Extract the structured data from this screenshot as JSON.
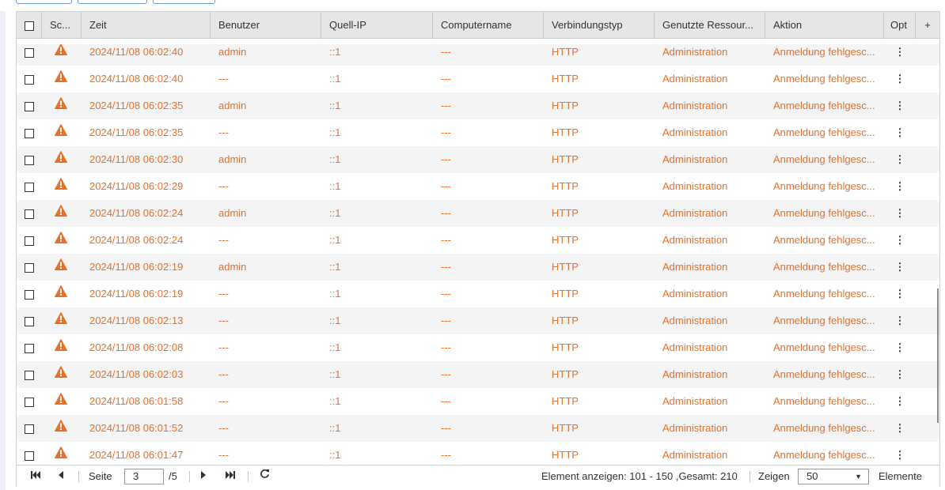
{
  "columns": {
    "select_all": "",
    "severity": "Sc...",
    "time": "Zeit",
    "user": "Benutzer",
    "source_ip": "Quell-IP",
    "computer_name": "Computername",
    "connection_type": "Verbindungstyp",
    "resource": "Genutzte Ressour...",
    "action": "Aktion",
    "options": "Opt",
    "add": "+"
  },
  "rows": [
    {
      "time": "2024/11/08 06:02:40",
      "user": "admin",
      "ip": "::1",
      "computer": "---",
      "conn": "HTTP",
      "resource": "Administration",
      "action": "Anmeldung fehlgesc...",
      "severity_icon": "warning-icon"
    },
    {
      "time": "2024/11/08 06:02:40",
      "user": "---",
      "ip": "::1",
      "computer": "---",
      "conn": "HTTP",
      "resource": "Administration",
      "action": "Anmeldung fehlgesc...",
      "severity_icon": "warning-icon"
    },
    {
      "time": "2024/11/08 06:02:35",
      "user": "admin",
      "ip": "::1",
      "computer": "---",
      "conn": "HTTP",
      "resource": "Administration",
      "action": "Anmeldung fehlgesc...",
      "severity_icon": "warning-icon"
    },
    {
      "time": "2024/11/08 06:02:35",
      "user": "---",
      "ip": "::1",
      "computer": "---",
      "conn": "HTTP",
      "resource": "Administration",
      "action": "Anmeldung fehlgesc...",
      "severity_icon": "warning-icon"
    },
    {
      "time": "2024/11/08 06:02:30",
      "user": "admin",
      "ip": "::1",
      "computer": "---",
      "conn": "HTTP",
      "resource": "Administration",
      "action": "Anmeldung fehlgesc...",
      "severity_icon": "warning-icon"
    },
    {
      "time": "2024/11/08 06:02:29",
      "user": "---",
      "ip": "::1",
      "computer": "---",
      "conn": "HTTP",
      "resource": "Administration",
      "action": "Anmeldung fehlgesc...",
      "severity_icon": "warning-icon"
    },
    {
      "time": "2024/11/08 06:02:24",
      "user": "admin",
      "ip": "::1",
      "computer": "---",
      "conn": "HTTP",
      "resource": "Administration",
      "action": "Anmeldung fehlgesc...",
      "severity_icon": "warning-icon"
    },
    {
      "time": "2024/11/08 06:02:24",
      "user": "---",
      "ip": "::1",
      "computer": "---",
      "conn": "HTTP",
      "resource": "Administration",
      "action": "Anmeldung fehlgesc...",
      "severity_icon": "warning-icon"
    },
    {
      "time": "2024/11/08 06:02:19",
      "user": "admin",
      "ip": "::1",
      "computer": "---",
      "conn": "HTTP",
      "resource": "Administration",
      "action": "Anmeldung fehlgesc...",
      "severity_icon": "warning-icon"
    },
    {
      "time": "2024/11/08 06:02:19",
      "user": "---",
      "ip": "::1",
      "computer": "---",
      "conn": "HTTP",
      "resource": "Administration",
      "action": "Anmeldung fehlgesc...",
      "severity_icon": "warning-icon"
    },
    {
      "time": "2024/11/08 06:02:13",
      "user": "---",
      "ip": "::1",
      "computer": "---",
      "conn": "HTTP",
      "resource": "Administration",
      "action": "Anmeldung fehlgesc...",
      "severity_icon": "warning-icon"
    },
    {
      "time": "2024/11/08 06:02:08",
      "user": "---",
      "ip": "::1",
      "computer": "---",
      "conn": "HTTP",
      "resource": "Administration",
      "action": "Anmeldung fehlgesc...",
      "severity_icon": "warning-icon"
    },
    {
      "time": "2024/11/08 06:02:03",
      "user": "---",
      "ip": "::1",
      "computer": "---",
      "conn": "HTTP",
      "resource": "Administration",
      "action": "Anmeldung fehlgesc...",
      "severity_icon": "warning-icon"
    },
    {
      "time": "2024/11/08 06:01:58",
      "user": "---",
      "ip": "::1",
      "computer": "---",
      "conn": "HTTP",
      "resource": "Administration",
      "action": "Anmeldung fehlgesc...",
      "severity_icon": "warning-icon"
    },
    {
      "time": "2024/11/08 06:01:52",
      "user": "---",
      "ip": "::1",
      "computer": "---",
      "conn": "HTTP",
      "resource": "Administration",
      "action": "Anmeldung fehlgesc...",
      "severity_icon": "warning-icon"
    },
    {
      "time": "2024/11/08 06:01:47",
      "user": "---",
      "ip": "::1",
      "computer": "---",
      "conn": "HTTP",
      "resource": "Administration",
      "action": "Anmeldung fehlgesc...",
      "severity_icon": "warning-icon"
    }
  ],
  "pagination": {
    "page_label": "Seite",
    "current_page": "3",
    "total_pages": "/5",
    "summary": "Element anzeigen: 101 - 150 ,Gesamt: 210",
    "show_label": "Zeigen",
    "page_size": "50",
    "items_label": "Elemente"
  },
  "icons": {
    "first": "first-page-icon",
    "prev": "prev-page-icon",
    "next": "next-page-icon",
    "last": "last-page-icon",
    "refresh": "refresh-icon",
    "row_options": "more-options-icon",
    "dropdown": "chevron-down-icon"
  },
  "colors": {
    "row_text": "#e8702a",
    "warning": "#e8702a",
    "header_bg": "#e6e6e6",
    "alt_row_bg": "#f4f4f4"
  }
}
